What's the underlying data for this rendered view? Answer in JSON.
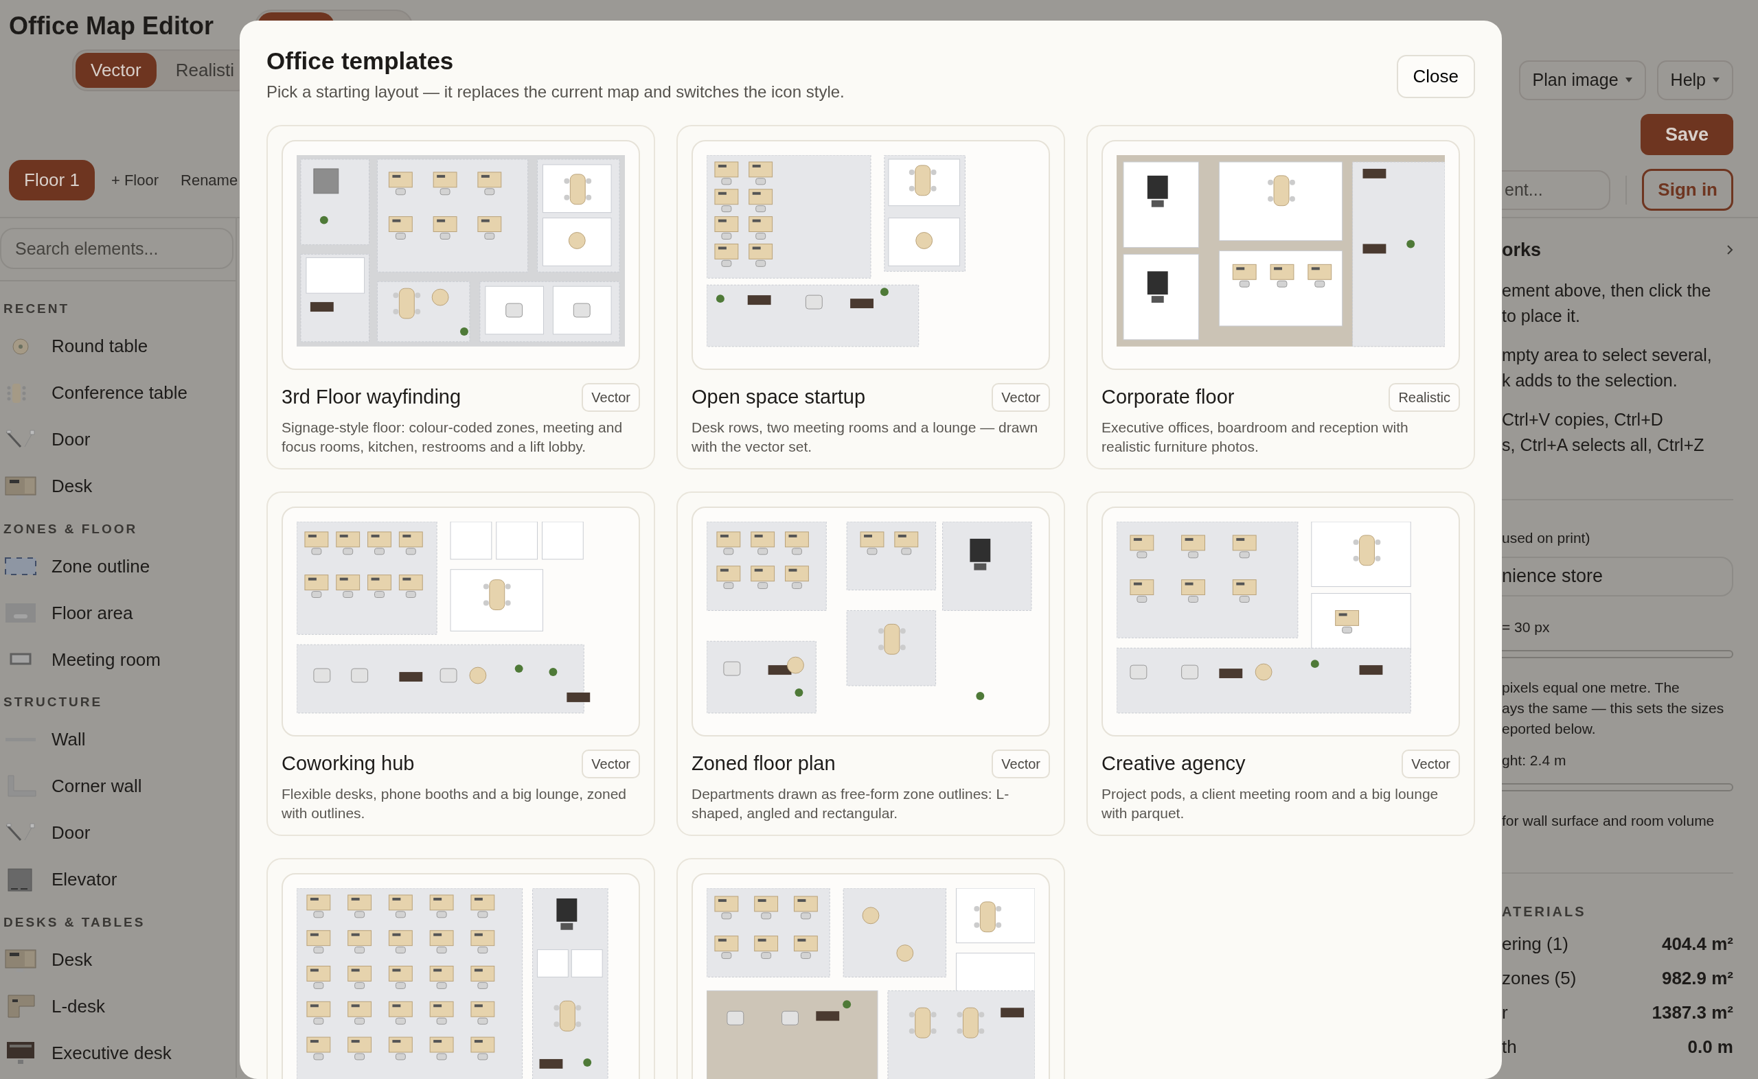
{
  "app": {
    "title": "Office Map Editor",
    "view_tabs": [
      {
        "selected": true
      }
    ],
    "style_toggle": [
      {
        "label": "Vector",
        "selected": true
      },
      {
        "label": "Realisti",
        "selected": false
      }
    ],
    "floors": [
      {
        "label": "Floor 1",
        "selected": true
      }
    ],
    "floor_actions": [
      "+ Floor",
      "Rename"
    ],
    "menus": [
      "Plan image",
      "Help"
    ],
    "save": "Save",
    "element_search": {
      "placeholder": "ent..."
    },
    "sign_in": "Sign in"
  },
  "sidebar": {
    "search": {
      "placeholder": "Search elements..."
    },
    "sections": [
      {
        "heading": "RECENT",
        "items": [
          {
            "label": "Round table",
            "kind": "round-table"
          },
          {
            "label": "Conference table",
            "kind": "conference-table"
          },
          {
            "label": "Door",
            "kind": "door"
          },
          {
            "label": "Desk",
            "kind": "desk"
          }
        ]
      },
      {
        "heading": "ZONES & FLOOR",
        "items": [
          {
            "label": "Zone outline",
            "kind": "zone-outline"
          },
          {
            "label": "Floor area",
            "kind": "floor-area"
          },
          {
            "label": "Meeting room",
            "kind": "meeting-room"
          }
        ]
      },
      {
        "heading": "STRUCTURE",
        "items": [
          {
            "label": "Wall",
            "kind": "wall"
          },
          {
            "label": "Corner wall",
            "kind": "corner-wall"
          },
          {
            "label": "Door",
            "kind": "door"
          },
          {
            "label": "Elevator",
            "kind": "elevator"
          }
        ]
      },
      {
        "heading": "DESKS & TABLES",
        "items": [
          {
            "label": "Desk",
            "kind": "desk"
          },
          {
            "label": "L-desk",
            "kind": "l-desk"
          },
          {
            "label": "Executive desk",
            "kind": "executive-desk"
          }
        ]
      }
    ]
  },
  "panel": {
    "heading": "orks",
    "tips": [
      [
        "ement above, then click the",
        "to place it."
      ],
      [
        "mpty area to select several,",
        "k adds to the selection."
      ],
      [
        "Ctrl+V copies, Ctrl+D",
        "s, Ctrl+A selects all, Ctrl+Z"
      ]
    ],
    "name_label": "used on print)",
    "name_value": "nience store",
    "scale_label": "= 30 px",
    "scale_help": [
      "pixels equal one metre. The",
      "ays the same — this sets the sizes",
      "eported below."
    ],
    "height_label": "ght: 2.4 m",
    "height_help": "for wall surface and room volume",
    "materials_heading": "ATERIALS",
    "materials": [
      {
        "label": "ering (1)",
        "value": "404.4 m²"
      },
      {
        "label": "zones (5)",
        "value": "982.9 m²"
      },
      {
        "label": "r",
        "value": "1387.3 m²"
      },
      {
        "label": "th",
        "value": "0.0 m"
      }
    ]
  },
  "modal": {
    "title": "Office templates",
    "subtitle": "Pick a starting layout — it replaces the current map and switches the icon style.",
    "close": "Close",
    "templates": [
      {
        "kind": "full",
        "title": "3rd Floor wayfinding",
        "badge": "Vector",
        "description": "Signage-style floor: colour-coded zones, meeting and focus rooms, kitchen, restrooms and a lift lobby."
      },
      {
        "kind": "full",
        "title": "Open space startup",
        "badge": "Vector",
        "description": "Desk rows, two meeting rooms and a lounge — drawn with the vector set."
      },
      {
        "kind": "full",
        "title": "Corporate floor",
        "badge": "Realistic",
        "description": "Executive offices, boardroom and reception with realistic furniture photos."
      },
      {
        "kind": "full",
        "title": "Coworking hub",
        "badge": "Vector",
        "description": "Flexible desks, phone booths and a big lounge, zoned with outlines."
      },
      {
        "kind": "full",
        "title": "Zoned floor plan",
        "badge": "Vector",
        "description": "Departments drawn as free-form zone outlines: L-shaped, angled and rectangular."
      },
      {
        "kind": "full",
        "title": "Creative agency",
        "badge": "Vector",
        "description": "Project pods, a client meeting room and a big lounge with parquet."
      },
      {
        "kind": "preview-only"
      },
      {
        "kind": "preview-only"
      }
    ]
  }
}
